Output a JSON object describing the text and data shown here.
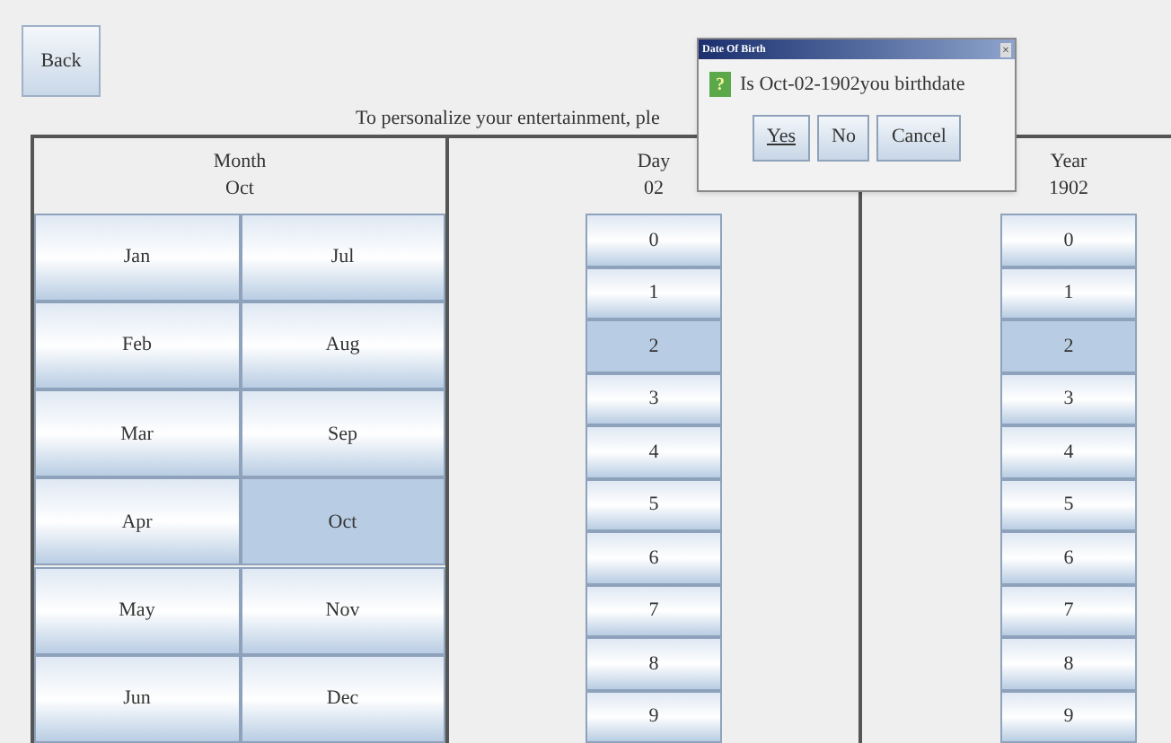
{
  "back_button": "Back",
  "instruction": "To personalize your entertainment, ple",
  "columns": [
    {
      "kind": "months",
      "title": "Month",
      "value": "Oct",
      "items": [
        {
          "label": "Jan",
          "selected": false
        },
        {
          "label": "Jul",
          "selected": false
        },
        {
          "label": "Feb",
          "selected": false
        },
        {
          "label": "Aug",
          "selected": false
        },
        {
          "label": "Mar",
          "selected": false
        },
        {
          "label": "Sep",
          "selected": false
        },
        {
          "label": "Apr",
          "selected": false
        },
        {
          "label": "Oct",
          "selected": true
        },
        {
          "label": "May",
          "selected": false
        },
        {
          "label": "Nov",
          "selected": false
        },
        {
          "label": "Jun",
          "selected": false
        },
        {
          "label": "Dec",
          "selected": false
        }
      ]
    },
    {
      "kind": "digits",
      "title": "Day",
      "value": "02",
      "items": [
        {
          "label": "0",
          "selected": false
        },
        {
          "label": "1",
          "selected": false
        },
        {
          "label": "2",
          "selected": true
        },
        {
          "label": "3",
          "selected": false
        },
        {
          "label": "4",
          "selected": false
        },
        {
          "label": "5",
          "selected": false
        },
        {
          "label": "6",
          "selected": false
        },
        {
          "label": "7",
          "selected": false
        },
        {
          "label": "8",
          "selected": false
        },
        {
          "label": "9",
          "selected": false
        }
      ]
    },
    {
      "kind": "digits",
      "title": "Year",
      "value": "1902",
      "items": [
        {
          "label": "0",
          "selected": false
        },
        {
          "label": "1",
          "selected": false
        },
        {
          "label": "2",
          "selected": true
        },
        {
          "label": "3",
          "selected": false
        },
        {
          "label": "4",
          "selected": false
        },
        {
          "label": "5",
          "selected": false
        },
        {
          "label": "6",
          "selected": false
        },
        {
          "label": "7",
          "selected": false
        },
        {
          "label": "8",
          "selected": false
        },
        {
          "label": "9",
          "selected": false
        }
      ]
    }
  ],
  "dialog": {
    "title": "Date Of Birth",
    "close": "×",
    "icon_text": "?",
    "message": "Is Oct-02-1902you birthdate",
    "buttons": [
      "Yes",
      "No",
      "Cancel"
    ]
  }
}
